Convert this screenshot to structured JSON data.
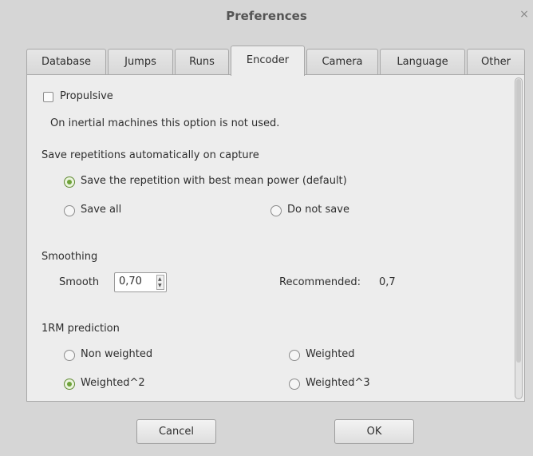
{
  "window": {
    "title": "Preferences",
    "close_glyph": "×"
  },
  "tabs": [
    {
      "label": "Database",
      "active": false
    },
    {
      "label": "Jumps",
      "active": false
    },
    {
      "label": "Runs",
      "active": false
    },
    {
      "label": "Encoder",
      "active": true
    },
    {
      "label": "Camera",
      "active": false
    },
    {
      "label": "Language",
      "active": false
    },
    {
      "label": "Other",
      "active": false
    }
  ],
  "encoder": {
    "propulsive": {
      "label": "Propulsive",
      "checked": false
    },
    "inertial_note": "On inertial machines this option is not used.",
    "save_section_label": "Save repetitions automatically on capture",
    "save_options": [
      {
        "label": "Save the repetition with best mean power  (default)",
        "selected": true
      },
      {
        "label": "Save all",
        "selected": false
      },
      {
        "label": "Do not save",
        "selected": false
      }
    ],
    "smoothing": {
      "section_label": "Smoothing",
      "smooth_label": "Smooth",
      "smooth_value": "0,70",
      "recommended_label": "Recommended:",
      "recommended_value": "0,7"
    },
    "prediction": {
      "section_label": "1RM prediction",
      "options": [
        {
          "label": "Non weighted",
          "selected": false
        },
        {
          "label": "Weighted",
          "selected": false
        },
        {
          "label": "Weighted^2",
          "selected": true
        },
        {
          "label": "Weighted^3",
          "selected": false
        }
      ]
    }
  },
  "buttons": {
    "cancel": "Cancel",
    "ok": "OK"
  },
  "colors": {
    "window_bg": "#d6d6d6",
    "panel_bg": "#ededed",
    "radio_selected": "#6ea23a"
  }
}
